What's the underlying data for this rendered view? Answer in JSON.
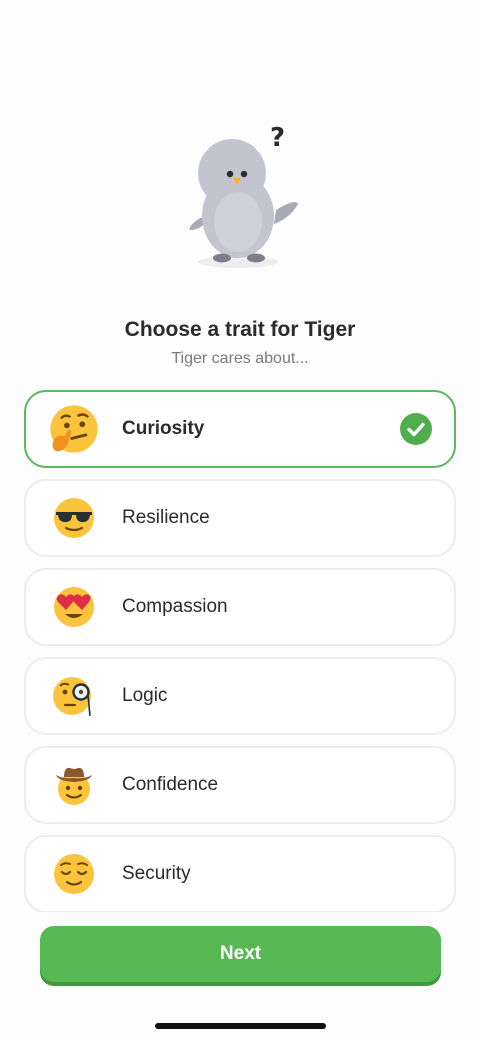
{
  "header": {
    "title": "Choose a trait for Tiger",
    "subtitle": "Tiger cares about...",
    "mascot_icon": "penguin-question-icon"
  },
  "options": [
    {
      "label": "Curiosity",
      "icon": "thinking-face-icon",
      "selected": true
    },
    {
      "label": "Resilience",
      "icon": "sunglasses-face-icon",
      "selected": false
    },
    {
      "label": "Compassion",
      "icon": "heart-eyes-face-icon",
      "selected": false
    },
    {
      "label": "Logic",
      "icon": "monocle-face-icon",
      "selected": false
    },
    {
      "label": "Confidence",
      "icon": "cowboy-face-icon",
      "selected": false
    },
    {
      "label": "Security",
      "icon": "relieved-face-icon",
      "selected": false
    }
  ],
  "footer": {
    "next_label": "Next"
  },
  "colors": {
    "accent": "#58b854",
    "selected_border": "#5cb85c",
    "emoji_yellow": "#fcc43d"
  }
}
